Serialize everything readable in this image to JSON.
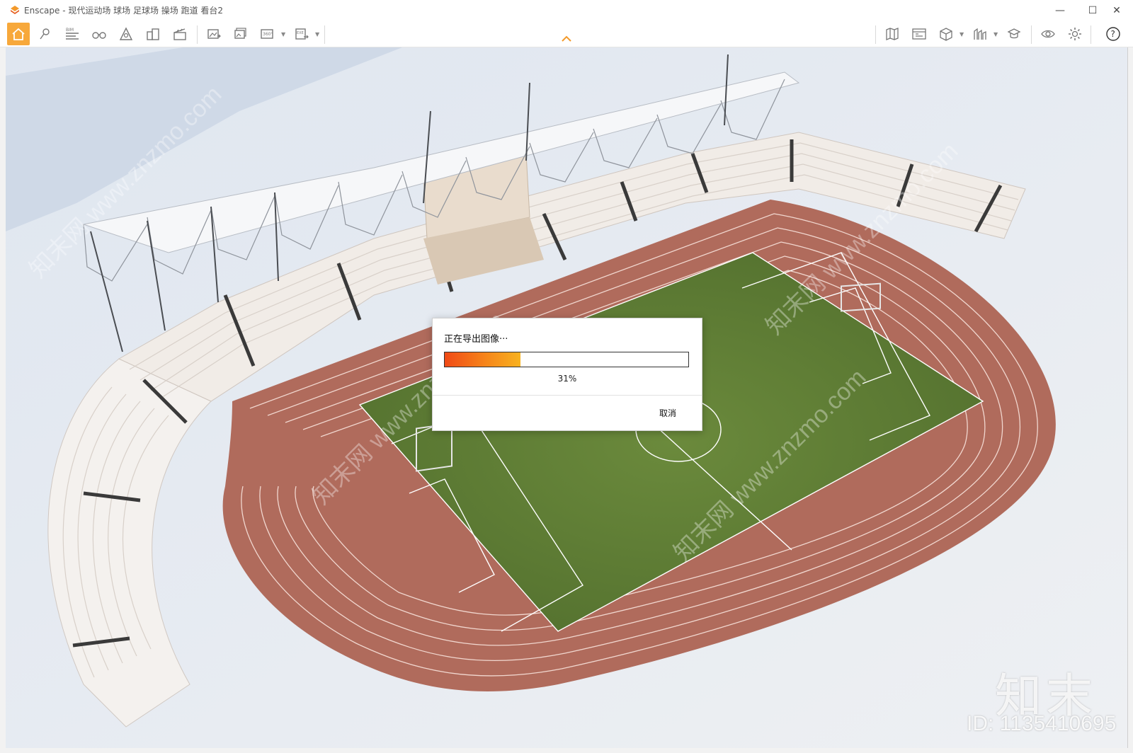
{
  "window": {
    "title": "Enscape - 现代运动场 球场 足球场 操场 跑道 看台2",
    "controls": {
      "minimize": "—",
      "maximize": "☐",
      "close": "✕"
    }
  },
  "toolbar": {
    "left_icons": [
      "home-icon",
      "pin-icon",
      "bim-icon",
      "binoculars-icon",
      "terrain-icon",
      "buildings-icon",
      "clapper-icon",
      "export-image-icon",
      "batch-export-icon",
      "panorama-360-icon",
      "export-exe-icon"
    ],
    "bim_label": "BIM",
    "pano_label": "360°",
    "exe_label": "EXE",
    "right_icons": [
      "map-icon",
      "asset-library-icon",
      "cube-icon",
      "chart-icon",
      "cap-icon",
      "eye-icon",
      "gear-icon",
      "help-icon"
    ],
    "help_label": "?"
  },
  "dialog": {
    "title": "正在导出图像···",
    "progress_percent": 31,
    "percent_label": "31%",
    "cancel_label": "取消"
  },
  "watermark": {
    "brand": "知末",
    "id_text": "ID: 1135410695",
    "diagonal_text": "知末网 www.znzmo.com"
  },
  "colors": {
    "accent": "#f7a83b",
    "track": "#b06b5c",
    "field": "#5c7a32",
    "sky_ground": "#e4e8ee",
    "progress_start": "#f04a16",
    "progress_end": "#f8b21f"
  }
}
